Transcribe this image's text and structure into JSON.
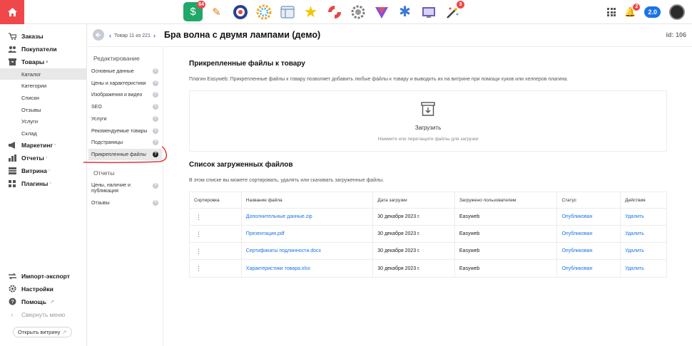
{
  "sidebar": {
    "nav": [
      {
        "label": "Заказы",
        "icon": "cart-icon"
      },
      {
        "label": "Покупатели",
        "icon": "users-icon"
      },
      {
        "label": "Товары",
        "icon": "box-icon"
      },
      {
        "label": "Маркетинг",
        "icon": "megaphone-icon"
      },
      {
        "label": "Отчеты",
        "icon": "chart-icon"
      },
      {
        "label": "Витрина",
        "icon": "storefront-icon"
      },
      {
        "label": "Плагины",
        "icon": "puzzle-icon"
      }
    ],
    "products_sub": [
      "Каталог",
      "Категории",
      "Списки",
      "Отзывы",
      "Услуги",
      "Склад"
    ],
    "bottom": [
      {
        "label": "Импорт-экспорт",
        "icon": "exchange-icon"
      },
      {
        "label": "Настройки",
        "icon": "gear-icon"
      },
      {
        "label": "Помощь",
        "icon": "help-icon"
      },
      {
        "label": "Свернуть меню",
        "icon": "collapse-icon"
      }
    ],
    "open_shop": "Открыть витрину"
  },
  "topbar": {
    "app_badges": {
      "app1": "64",
      "app12": "3"
    },
    "notifications_count": "2",
    "version": "2.0",
    "colors": {
      "home": "#f0484a",
      "badge": "#f0484a",
      "accent": "#1a73e8"
    }
  },
  "header": {
    "breadcrumb": "Товар 11 из 221",
    "title": "Бра волна с двумя лампами (демо)",
    "id": "id: 106"
  },
  "sub_panel": {
    "edit_heading": "Редактирование",
    "edit_links": [
      "Основные данные",
      "Цены и характеристики",
      "Изображения и видео",
      "SEO",
      "Услуги",
      "Рекомендуемые товары",
      "Подстраницы",
      "Прикрепленные файлы"
    ],
    "reports_heading": "Отчеты",
    "reports_links": [
      "Цены, наличие и публикация",
      "Отзывы"
    ]
  },
  "main": {
    "section1_title": "Прикрепленные файлы к товару",
    "section1_desc": "Плагин Easyweb: Прикрепленные файлы к товару позволяет добавить любые файлы к товару и выводить их на витрине при помощи хуков или хелперов плагина.",
    "upload_title": "Загрузить",
    "upload_hint": "Нажмите или перетащите файлы для загрузки",
    "section2_title": "Список загруженных файлов",
    "section2_desc": "В этом списке вы можете сортировать, удалять или скачивать загруженные файлы.",
    "columns": [
      "Сортировка",
      "Название файла",
      "Дата загрузки",
      "Загружено пользователем",
      "Статус",
      "Действия"
    ],
    "rows": [
      {
        "name": "Дополнительные данные.zip",
        "date": "30 декабря 2023 г.",
        "user": "Easyweb",
        "status": "Опубликован",
        "action": "Удалить"
      },
      {
        "name": "Презентация.pdf",
        "date": "30 декабря 2023 г.",
        "user": "Easyweb",
        "status": "Опубликован",
        "action": "Удалить"
      },
      {
        "name": "Сертификаты подлинности.docx",
        "date": "30 декабря 2023 г.",
        "user": "Easyweb",
        "status": "Опубликован",
        "action": "Удалить"
      },
      {
        "name": "Характеристики товара.xlsx",
        "date": "30 декабря 2023 г.",
        "user": "Easyweb",
        "status": "Опубликован",
        "action": "Удалить"
      }
    ]
  }
}
